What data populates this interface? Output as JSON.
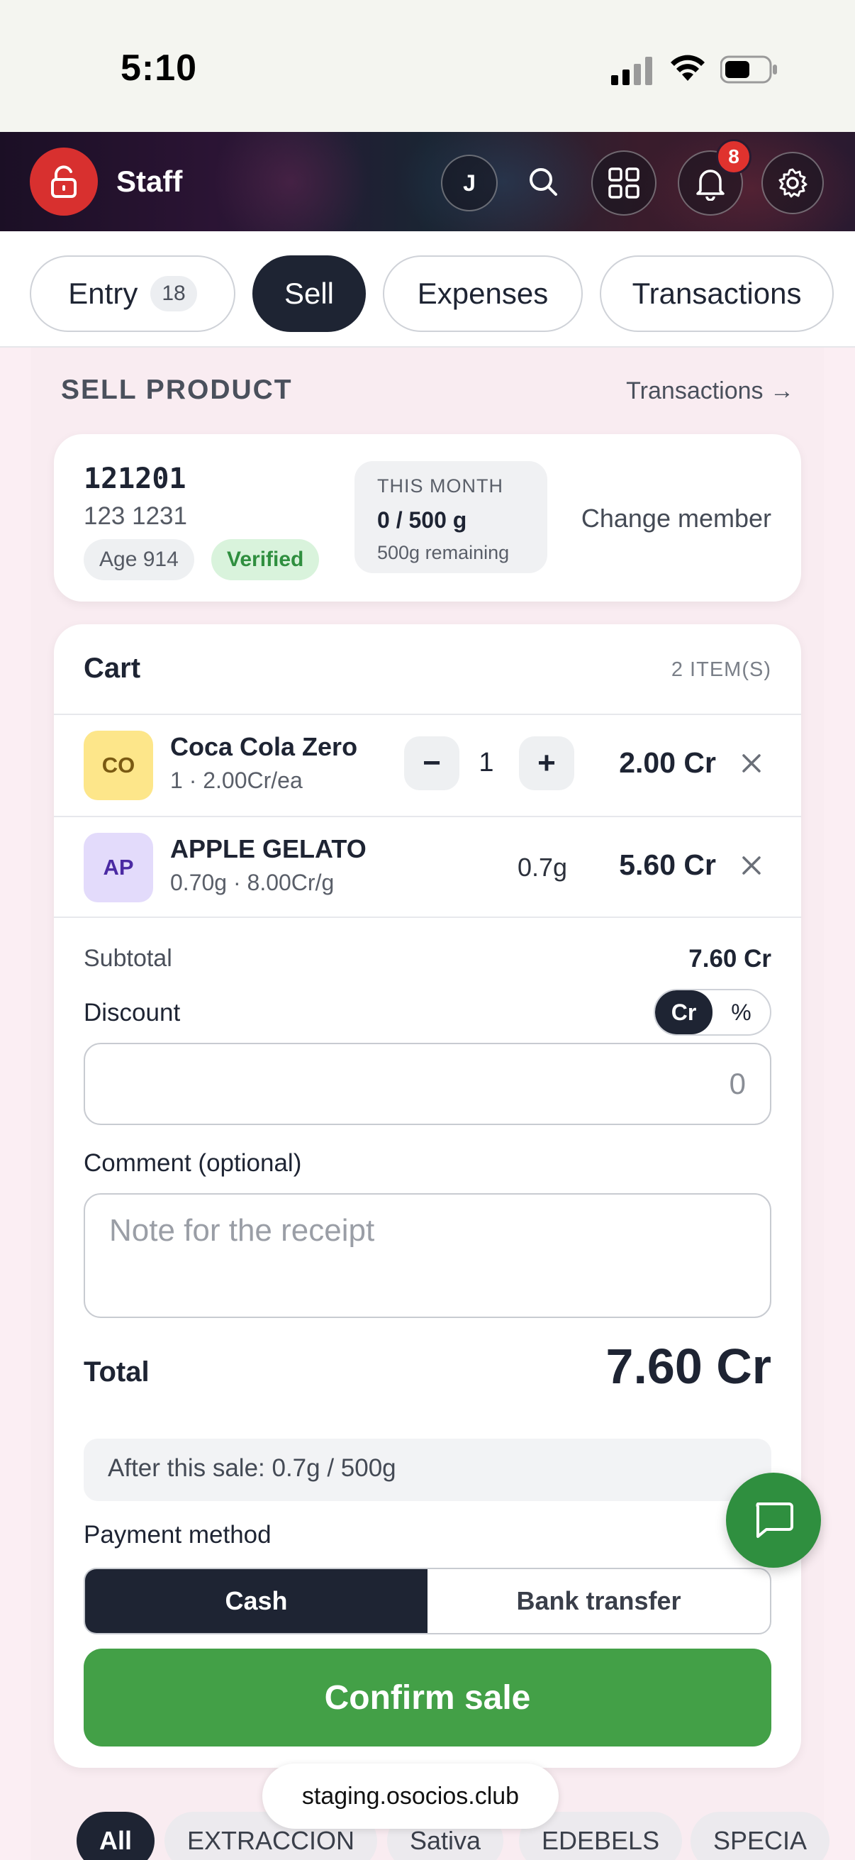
{
  "status": {
    "time": "5:10"
  },
  "header": {
    "title": "Staff",
    "avatar_initial": "J",
    "notification_count": "8"
  },
  "tabs": [
    {
      "label": "Entry",
      "count": "18",
      "active": false
    },
    {
      "label": "Sell",
      "active": true
    },
    {
      "label": "Expenses",
      "active": false
    },
    {
      "label": "Transactions",
      "active": false
    }
  ],
  "section": {
    "title": "SELL PRODUCT",
    "link": "Transactions →"
  },
  "member": {
    "id": "121201",
    "phone": "123 1231",
    "age": "Age 914",
    "verified": "Verified",
    "month_label": "THIS MONTH",
    "month_value": "0 / 500 g",
    "month_remaining": "500g remaining",
    "change_label": "Change member"
  },
  "cart": {
    "title": "Cart",
    "count_label": "2 ITEM(S)",
    "items": [
      {
        "initials": "CO",
        "name": "Coca Cola Zero",
        "detail": "1 · 2.00Cr/ea",
        "qty": "1",
        "minus": "−",
        "plus": "+",
        "price": "2.00 Cr",
        "thumb_color": "#fde68a"
      },
      {
        "initials": "AP",
        "name": "APPLE GELATO",
        "detail": "0.70g · 8.00Cr/g",
        "weight": "0.7g",
        "price": "5.60 Cr",
        "thumb_color": "#e3dbfb"
      }
    ],
    "subtotal_label": "Subtotal",
    "subtotal_value": "7.60 Cr",
    "discount_label": "Discount",
    "discount_unit_cr": "Cr",
    "discount_unit_pct": "%",
    "discount_placeholder": "0",
    "comment_label": "Comment (optional)",
    "comment_placeholder": "Note for the receipt",
    "total_label": "Total",
    "total_value": "7.60 Cr",
    "after_sale": "After this sale: 0.7g / 500g",
    "payment_label": "Payment method",
    "payment_cash": "Cash",
    "payment_bank": "Bank transfer",
    "confirm_label": "Confirm sale"
  },
  "browser": {
    "url": "staging.osocios.club"
  },
  "categories": [
    "All",
    "EXTRACCION",
    "Sativa",
    "EDEBELS",
    "SPECIA"
  ]
}
